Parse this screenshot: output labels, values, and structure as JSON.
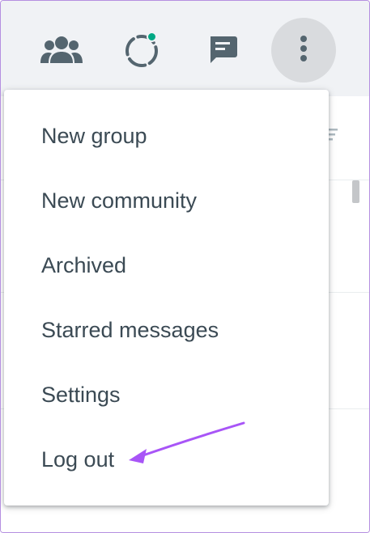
{
  "header": {
    "icons": [
      {
        "name": "communities-icon"
      },
      {
        "name": "status-icon"
      },
      {
        "name": "new-chat-icon"
      },
      {
        "name": "menu-icon"
      }
    ]
  },
  "menu": {
    "items": [
      {
        "label": "New group"
      },
      {
        "label": "New community"
      },
      {
        "label": "Archived"
      },
      {
        "label": "Starred messages"
      },
      {
        "label": "Settings"
      },
      {
        "label": "Log out"
      }
    ]
  },
  "colors": {
    "header_bg": "#f0f2f5",
    "icon": "#54656f",
    "status_dot": "#00a884",
    "menu_text": "#3b4a54",
    "annotation_arrow": "#a855f7"
  }
}
